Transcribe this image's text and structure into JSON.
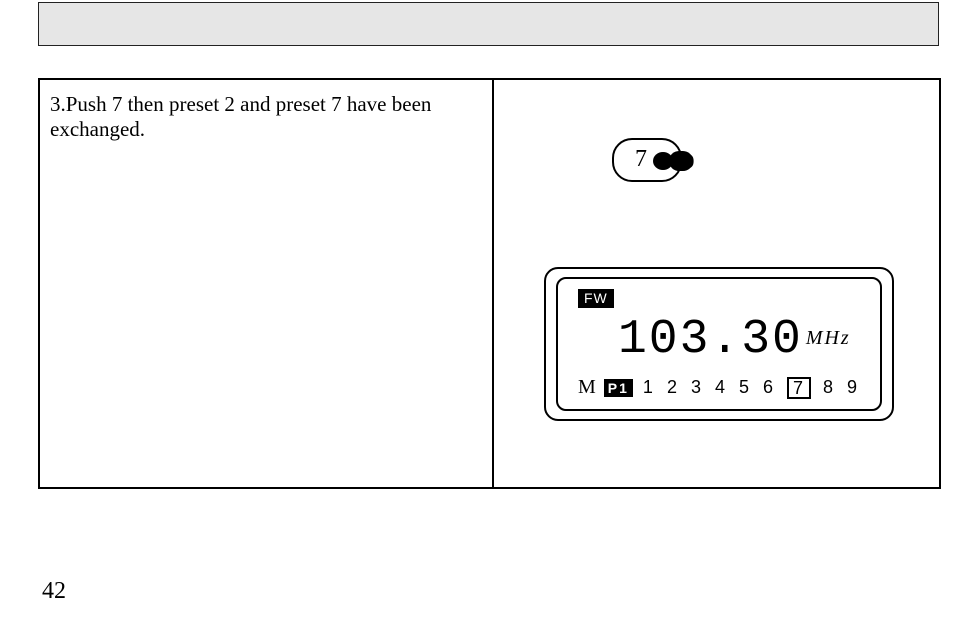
{
  "instruction": "3.Push 7 then preset 2 and preset 7 have been exchanged.",
  "button": {
    "label": "7"
  },
  "lcd": {
    "band": "FW",
    "frequency": "103.30",
    "unit": "MHz",
    "memory_indicator": "M",
    "page_indicator": "P1",
    "presets": [
      "1",
      "2",
      "3",
      "4",
      "5",
      "6",
      "7",
      "8",
      "9"
    ],
    "selected_preset_index": 6
  },
  "page_number": "42"
}
